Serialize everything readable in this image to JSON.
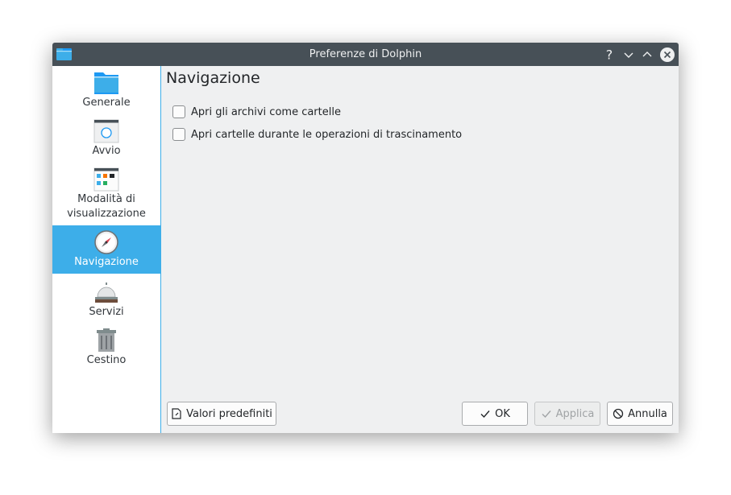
{
  "window": {
    "title": "Preferenze di Dolphin"
  },
  "titlebar": {
    "help_label": "?"
  },
  "sidebar": {
    "items": [
      {
        "label": "Generale",
        "icon": "folder-icon"
      },
      {
        "label": "Avvio",
        "icon": "window-icon"
      },
      {
        "label": "Modalità di visualizzazione",
        "icon": "view-modes-icon"
      },
      {
        "label": "Navigazione",
        "icon": "compass-icon",
        "selected": true
      },
      {
        "label": "Servizi",
        "icon": "service-bell-icon"
      },
      {
        "label": "Cestino",
        "icon": "trash-icon"
      }
    ]
  },
  "page": {
    "title": "Navigazione",
    "options": [
      {
        "label": "Apri gli archivi come cartelle",
        "checked": false
      },
      {
        "label": "Apri cartelle durante le operazioni di trascinamento",
        "checked": false
      }
    ]
  },
  "buttons": {
    "defaults": "Valori predefiniti",
    "ok": "OK",
    "apply": "Applica",
    "cancel": "Annulla"
  },
  "colors": {
    "titlebar": "#475057",
    "accent": "#3daee9",
    "window_bg": "#eff0f1"
  }
}
